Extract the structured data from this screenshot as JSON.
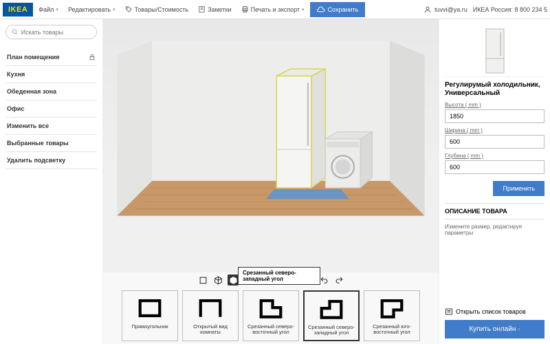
{
  "header": {
    "logo": "IKEA",
    "menu": {
      "file": "Файл",
      "edit": "Редактировать",
      "products": "Товары/Стоимость",
      "notes": "Заметки",
      "print": "Печать и экспорт",
      "save": "Сохранить"
    },
    "user": "tuvvi@ya.ru",
    "phone": "ИКЕА Россия: 8 800 234 5"
  },
  "search": {
    "placeholder": "Искать товары"
  },
  "sidebar": {
    "items": [
      "План помещения",
      "Кухня",
      "Обеденная зона",
      "Офис",
      "Изменить все",
      "Выбранные товары",
      "Удалить подсветку"
    ]
  },
  "tooltip": "Срезанный северо-западный угол",
  "shapes": [
    {
      "label": "Прямоугольник"
    },
    {
      "label": "Открытый вид комнаты"
    },
    {
      "label": "Срезанный северо-восточный угол"
    },
    {
      "label": "Срезанный северо-западный угол"
    },
    {
      "label": "Срезанный юго-восточный угол"
    }
  ],
  "product": {
    "title": "Регулирумый холодильник, Универсальный",
    "height_label": "Высота ( mm )",
    "height": "1850",
    "width_label": "Ширина ( mm )",
    "width": "600",
    "depth_label": "Глубина ( mm )",
    "depth": "600",
    "apply": "Применить",
    "desc_head": "ОПИСАНИЕ ТОВАРА",
    "desc_text": "Измените размер, редактируя параметры"
  },
  "footer": {
    "open_list": "Открыть список товаров",
    "buy": "Купить онлайн"
  }
}
